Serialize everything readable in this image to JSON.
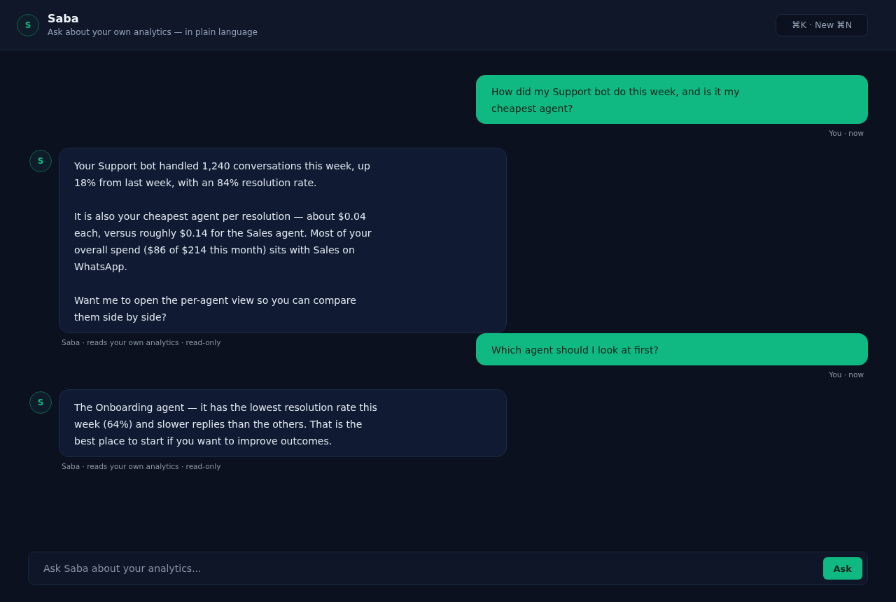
{
  "header": {
    "avatar": "S",
    "title": "Saba",
    "subtitle": "Ask about your own analytics — in plain language",
    "shortcut_button": "⌘K · New ⌘N"
  },
  "messages": [
    {
      "kind": "user",
      "paragraphs": [
        "How did my Support bot do this week, and is it my cheapest agent?"
      ],
      "meta": "You · now"
    },
    {
      "kind": "assistant",
      "avatar": "S",
      "paragraphs": [
        "Your Support bot handled 1,240 conversations this week, up 18% from last week, with an 84% resolution rate.",
        "It is also your cheapest agent per resolution — about $0.04 each, versus roughly $0.14 for the Sales agent. Most of your overall spend ($86 of $214 this month) sits with Sales on WhatsApp.",
        "Want me to open the per-agent view so you can compare them side by side?"
      ],
      "meta": "Saba · reads your own analytics · read-only"
    },
    {
      "kind": "user",
      "paragraphs": [
        "Which agent should I look at first?"
      ],
      "meta": "You · now"
    },
    {
      "kind": "assistant",
      "avatar": "S",
      "paragraphs": [
        "The Onboarding agent — it has the lowest resolution rate this week (64%) and slower replies than the others. That is the best place to start if you want to improve outcomes."
      ],
      "meta": "Saba · reads your own analytics · read-only"
    }
  ],
  "composer": {
    "placeholder": "Ask Saba about your analytics...",
    "button": "Ask"
  }
}
